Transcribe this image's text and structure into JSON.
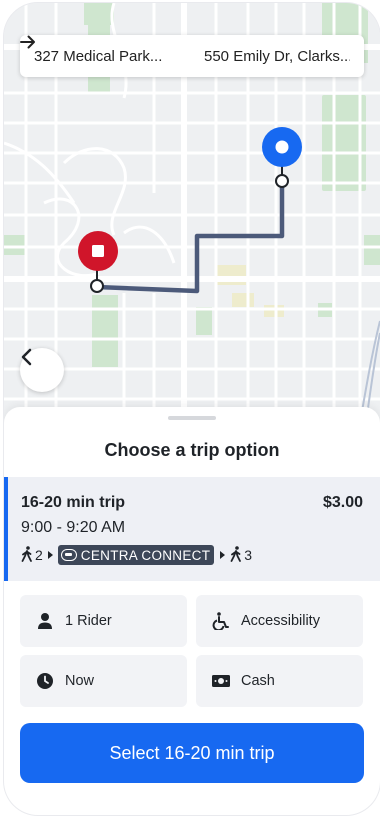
{
  "route": {
    "origin": "327 Medical Park...",
    "destination": "550 Emily Dr, Clarks..."
  },
  "sheet": {
    "title": "Choose a trip option"
  },
  "trip": {
    "duration": "16-20 min trip",
    "price": "$3.00",
    "time_range": "9:00 - 9:20 AM",
    "walk_before": "2",
    "agency": "CENTRA CONNECT",
    "walk_after": "3"
  },
  "options": {
    "riders": "1 Rider",
    "accessibility": "Accessibility",
    "when": "Now",
    "payment": "Cash"
  },
  "action": {
    "select_label": "Select 16-20 min trip"
  },
  "icons": {
    "route_arrow": "arrow-right-icon",
    "back": "chevron-left-icon",
    "origin_marker": "stop-marker-icon",
    "destination_marker": "destination-pin-icon",
    "walk": "walking-person-icon",
    "rider": "person-icon",
    "accessibility": "wheelchair-icon",
    "time": "clock-icon",
    "cash": "cash-icon"
  },
  "colors": {
    "accent": "#1769f1",
    "origin_marker": "#d0152a",
    "route_line": "#4c5a7a",
    "badge_bg": "#3d4758"
  }
}
